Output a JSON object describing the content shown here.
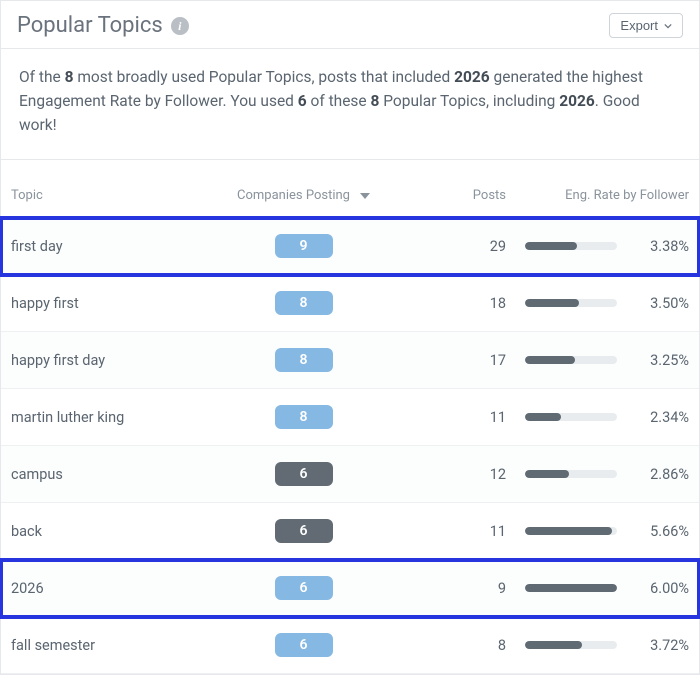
{
  "header": {
    "title": "Popular Topics",
    "export_label": "Export"
  },
  "summary": {
    "text_parts": [
      "Of the ",
      "8",
      " most broadly used Popular Topics, posts that included ",
      "2026",
      " generated the highest Engagement Rate by Follower. You used ",
      "6",
      " of these ",
      "8",
      " Popular Topics, including ",
      "2026",
      ". Good work!"
    ]
  },
  "table": {
    "headers": {
      "topic": "Topic",
      "companies": "Companies Posting",
      "posts": "Posts",
      "eng": "Eng. Rate by Follower"
    },
    "rows": [
      {
        "topic": "first day",
        "companies": 9,
        "pill": "blue",
        "posts": 29,
        "eng": 3.38,
        "highlight": true
      },
      {
        "topic": "happy first",
        "companies": 8,
        "pill": "blue",
        "posts": 18,
        "eng": 3.5,
        "highlight": false
      },
      {
        "topic": "happy first day",
        "companies": 8,
        "pill": "blue",
        "posts": 17,
        "eng": 3.25,
        "highlight": false
      },
      {
        "topic": "martin luther king",
        "companies": 8,
        "pill": "blue",
        "posts": 11,
        "eng": 2.34,
        "highlight": false
      },
      {
        "topic": "campus",
        "companies": 6,
        "pill": "gray",
        "posts": 12,
        "eng": 2.86,
        "highlight": false
      },
      {
        "topic": "back",
        "companies": 6,
        "pill": "gray",
        "posts": 11,
        "eng": 5.66,
        "highlight": false
      },
      {
        "topic": "2026",
        "companies": 6,
        "pill": "blue",
        "posts": 9,
        "eng": 6.0,
        "highlight": true
      },
      {
        "topic": "fall semester",
        "companies": 6,
        "pill": "blue",
        "posts": 8,
        "eng": 3.72,
        "highlight": false
      }
    ]
  },
  "chart_data": {
    "type": "table",
    "title": "Popular Topics",
    "columns": [
      "Topic",
      "Companies Posting",
      "Posts",
      "Eng. Rate by Follower (%)"
    ],
    "rows": [
      [
        "first day",
        9,
        29,
        3.38
      ],
      [
        "happy first",
        8,
        18,
        3.5
      ],
      [
        "happy first day",
        8,
        17,
        3.25
      ],
      [
        "martin luther king",
        8,
        11,
        2.34
      ],
      [
        "campus",
        6,
        12,
        2.86
      ],
      [
        "back",
        6,
        11,
        5.66
      ],
      [
        "2026",
        6,
        9,
        6.0
      ],
      [
        "fall semester",
        6,
        8,
        3.72
      ]
    ],
    "eng_rate_bar_max": 6.0
  }
}
